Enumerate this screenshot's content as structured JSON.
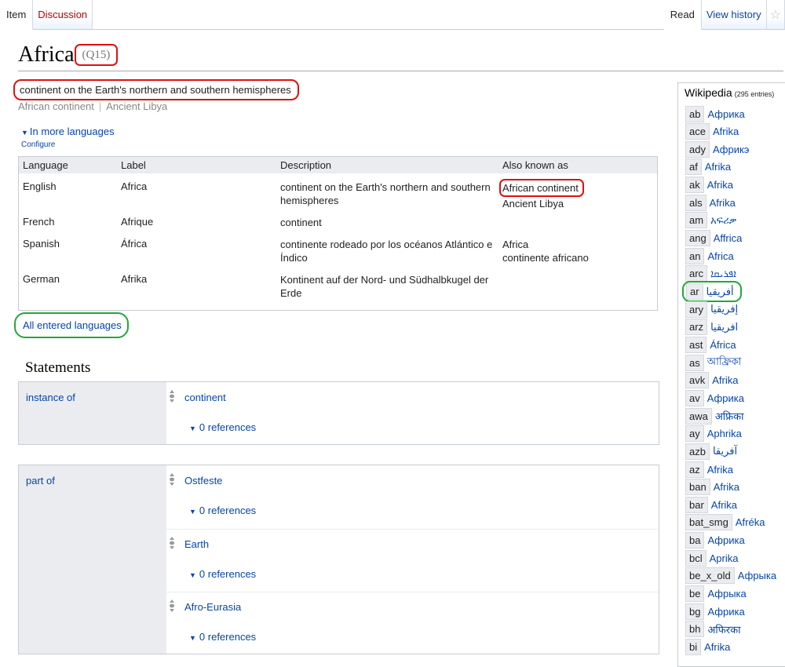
{
  "tabs": {
    "item": "Item",
    "discussion": "Discussion",
    "read": "Read",
    "view_history": "View history",
    "watch_icon": "star-icon"
  },
  "header": {
    "title": "Africa",
    "qid": "(Q15)"
  },
  "summary": {
    "description": "continent on the Earth's northern and southern hemispheres",
    "aliases": [
      "African continent",
      "Ancient Libya"
    ]
  },
  "more_languages": {
    "toggle_label": "In more languages",
    "configure_label": "Configure",
    "headers": [
      "Language",
      "Label",
      "Description",
      "Also known as"
    ],
    "rows": [
      {
        "language": "English",
        "label": "Africa",
        "description": "continent on the Earth's northern and southern hemispheres",
        "aliases": [
          "African continent",
          "Ancient Libya"
        ]
      },
      {
        "language": "French",
        "label": "Afrique",
        "description": "continent",
        "aliases": []
      },
      {
        "language": "Spanish",
        "label": "África",
        "description": "continente rodeado por los océanos Atlántico e Índico",
        "aliases": [
          "Africa",
          "continente africano"
        ]
      },
      {
        "language": "German",
        "label": "Afrika",
        "description": "Kontinent auf der Nord- und Südhalbkugel der Erde",
        "aliases": []
      }
    ],
    "all_entered_label": "All entered languages"
  },
  "statements": {
    "heading": "Statements",
    "groups": [
      {
        "property": "instance of",
        "values": [
          {
            "value": "continent",
            "references": "0 references"
          }
        ]
      },
      {
        "property": "part of",
        "values": [
          {
            "value": "Ostfeste",
            "references": "0 references"
          },
          {
            "value": "Earth",
            "references": "0 references"
          },
          {
            "value": "Afro-Eurasia",
            "references": "0 references"
          }
        ]
      }
    ]
  },
  "wikipedia": {
    "title": "Wikipedia",
    "count": "(295 entries)",
    "links": [
      {
        "code": "ab",
        "title": "Африка"
      },
      {
        "code": "ace",
        "title": "Afrika"
      },
      {
        "code": "ady",
        "title": "Африкэ"
      },
      {
        "code": "af",
        "title": "Afrika"
      },
      {
        "code": "ak",
        "title": "Afrika"
      },
      {
        "code": "als",
        "title": "Afrika"
      },
      {
        "code": "am",
        "title": "አፍሪቃ"
      },
      {
        "code": "ang",
        "title": "Affrica"
      },
      {
        "code": "an",
        "title": "Africa"
      },
      {
        "code": "arc",
        "title": "ܐܦܪܝܩܐ"
      },
      {
        "code": "ar",
        "title": "أفريقيا"
      },
      {
        "code": "ary",
        "title": "إفريقيا"
      },
      {
        "code": "arz",
        "title": "افريقيا"
      },
      {
        "code": "ast",
        "title": "África"
      },
      {
        "code": "as",
        "title": "আফ্ৰিকা"
      },
      {
        "code": "avk",
        "title": "Afrika"
      },
      {
        "code": "av",
        "title": "Африка"
      },
      {
        "code": "awa",
        "title": "अफ्रिका"
      },
      {
        "code": "ay",
        "title": "Aphrika"
      },
      {
        "code": "azb",
        "title": "آفریقا"
      },
      {
        "code": "az",
        "title": "Afrika"
      },
      {
        "code": "ban",
        "title": "Afrika"
      },
      {
        "code": "bar",
        "title": "Afrika"
      },
      {
        "code": "bat_smg",
        "title": "Afréka"
      },
      {
        "code": "ba",
        "title": "Африка"
      },
      {
        "code": "bcl",
        "title": "Aprika"
      },
      {
        "code": "be_x_old",
        "title": "Афрыка"
      },
      {
        "code": "be",
        "title": "Афрыка"
      },
      {
        "code": "bg",
        "title": "Африка"
      },
      {
        "code": "bh",
        "title": "अफिरका"
      },
      {
        "code": "bi",
        "title": "Afrika"
      }
    ]
  },
  "colors": {
    "link": "#0645ad",
    "red_link": "#ba0000",
    "highlight_red": "#e01010",
    "highlight_green": "#22a83a",
    "panel_bg": "#eaecf0"
  }
}
